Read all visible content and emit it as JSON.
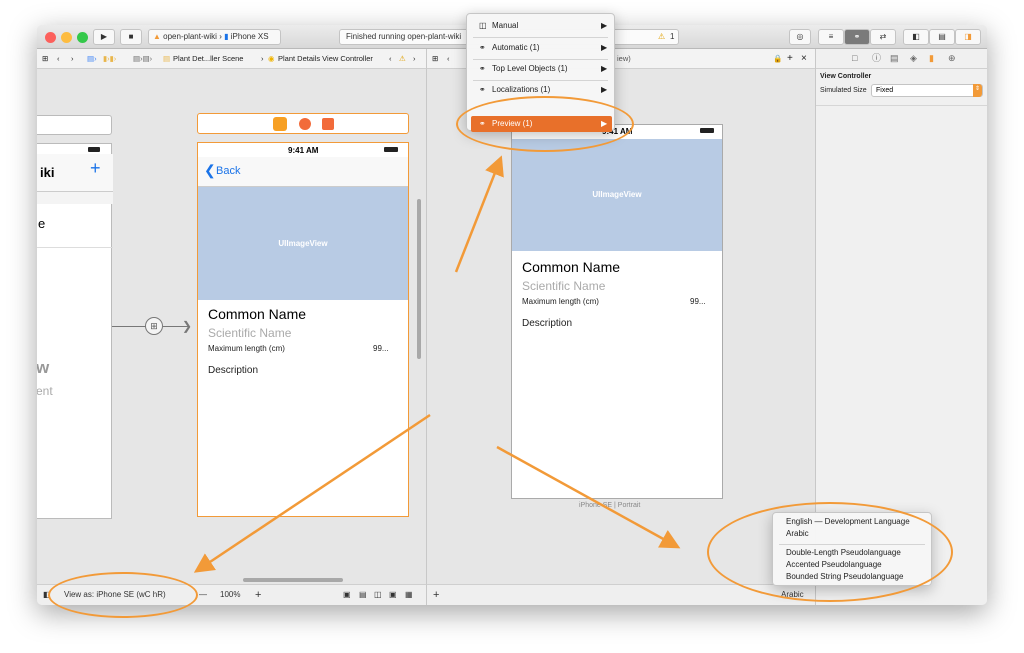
{
  "colors": {
    "accent": "#f29a38",
    "ios_blue": "#1a73e8",
    "image_placeholder": "#b8cbe4"
  },
  "toolbar": {
    "scheme": "open-plant-wiki",
    "device": "iPhone XS",
    "status": "Finished running open-plant-wiki",
    "warning_count": "1"
  },
  "jumpbar_left": {
    "crumb_scene": "Plant Det...ller Scene",
    "crumb_controller": "Plant Details View Controller"
  },
  "left_canvas": {
    "prev_partial_title": "iki",
    "prev_partial_row": "e",
    "prev_partial_big": "w",
    "prev_partial_sub": "ent",
    "time": "9:41 AM",
    "back": "Back",
    "image_label": "UIImageView",
    "common_name": "Common Name",
    "scientific_name": "Scientific Name",
    "max_length_label": "Maximum length (cm)",
    "max_length_value": "99...",
    "description": "Description"
  },
  "preview": {
    "time_partial": "9:41 AM",
    "image_label": "UIImageView",
    "common_name": "Common Name",
    "scientific_name": "Scientific Name",
    "max_length_label": "Maximum length (cm)",
    "max_length_value": "99...",
    "description": "Description",
    "device_caption": "iPhone SE | Portrait",
    "jump_partial": "iew)"
  },
  "assistant_menu": {
    "items": [
      "Manual",
      "Automatic (1)",
      "Top Level Objects (1)",
      "Localizations (1)",
      "Preview (1)"
    ]
  },
  "language_menu": {
    "items": [
      "English — Development Language",
      "Arabic",
      "Double-Length Pseudolanguage",
      "Accented Pseudolanguage",
      "Bounded String Pseudolanguage"
    ]
  },
  "inspector": {
    "section": "View Controller",
    "simulated_size_label": "Simulated Size",
    "simulated_size_value": "Fixed"
  },
  "bottom_left": {
    "view_as": "View as: iPhone SE (wC hR)",
    "zoom": "100%"
  },
  "bottom_right": {
    "language": "Arabic"
  }
}
